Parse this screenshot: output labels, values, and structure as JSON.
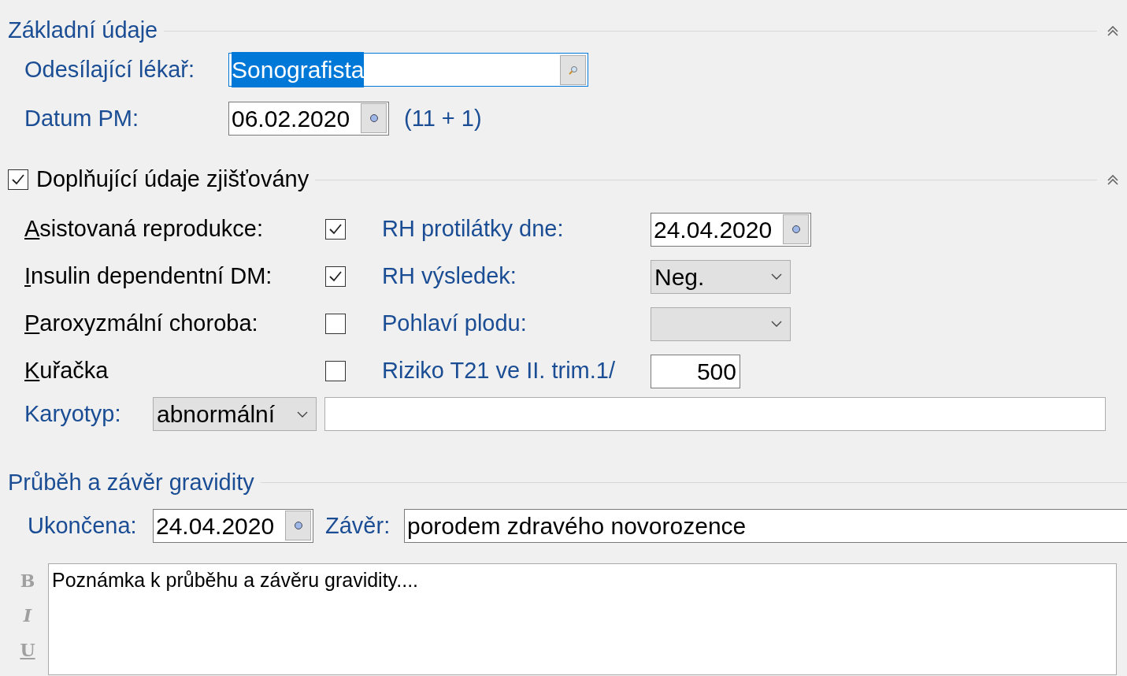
{
  "basic": {
    "title": "Základní údaje",
    "expanded": true,
    "referrer": {
      "label": "Odesílající lékař:",
      "value": "Sonografista",
      "text_selected": true
    },
    "lmp": {
      "label": "Datum PM:",
      "value": "06.02.2020",
      "gestation": "(11 + 1)"
    }
  },
  "additional": {
    "title": "Doplňující údaje zjišťovány",
    "checked": true,
    "expanded": true,
    "rows": [
      {
        "label": "Asistovaná reprodukce:",
        "mnemonic": true,
        "checked": true,
        "right_label": "RH protilátky dne:",
        "kind": "date",
        "right_value": "24.04.2020"
      },
      {
        "label": "Insulin dependentní DM:",
        "mnemonic": true,
        "checked": true,
        "right_label": "RH výsledek:",
        "kind": "select",
        "right_value": "Neg."
      },
      {
        "label": "Paroxyzmální choroba:",
        "mnemonic": true,
        "checked": false,
        "right_label": "Pohlaví plodu:",
        "kind": "select"
      },
      {
        "label": "Kuřačka",
        "mnemonic": true,
        "checked": false,
        "right_label": "Riziko T21 ve II. trim.1/",
        "kind": "number",
        "right_value": "500"
      }
    ],
    "karyotype": {
      "label": "Karyotyp:",
      "value": "abnormální"
    }
  },
  "outcome": {
    "title": "Průběh a závěr gravidity",
    "ended_label": "Ukončena:",
    "ended_date": "24.04.2020",
    "conclusion_label": "Závěr:",
    "conclusion": "porodem zdravého novorozence"
  },
  "note": {
    "toolbar": [
      {
        "kind": "bold",
        "glyph": "B"
      },
      {
        "kind": "italic",
        "glyph": "I"
      },
      {
        "kind": "underline",
        "glyph": "U"
      }
    ],
    "text": "Poznámka k průběhu a závěru gravidity...."
  }
}
